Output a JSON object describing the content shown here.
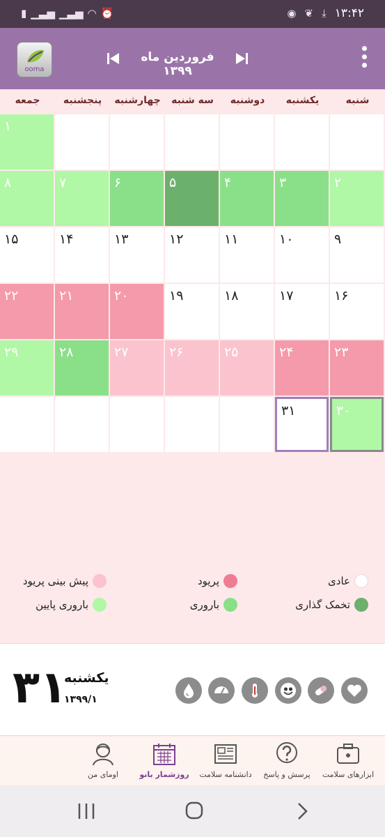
{
  "status_bar": {
    "time": "۱۳:۴۲",
    "left_icons": [
      "battery-saver-icon",
      "signal-icon",
      "signal-icon",
      "wifi-icon",
      "alarm-icon"
    ],
    "right_icons": [
      "trash-icon",
      "app-leaf-icon",
      "download-icon"
    ]
  },
  "header": {
    "logo_text": "ooma",
    "month_title": "فروردین ماه ۱۳۹۹",
    "prev_icon": "previous-month-icon",
    "next_icon": "next-month-icon",
    "menu_icon": "more-vert-icon"
  },
  "weekdays": [
    "شنبه",
    "یکشنبه",
    "دوشنبه",
    "سه شنبه",
    "چهارشنبه",
    "پنجشنبه",
    "جمعه"
  ],
  "calendar": {
    "rows": [
      [
        {
          "n": "",
          "t": "empty"
        },
        {
          "n": "",
          "t": "empty"
        },
        {
          "n": "",
          "t": "empty"
        },
        {
          "n": "",
          "t": "empty"
        },
        {
          "n": "",
          "t": "empty"
        },
        {
          "n": "",
          "t": "empty"
        },
        {
          "n": "۱",
          "t": "low"
        }
      ],
      [
        {
          "n": "۲",
          "t": "low"
        },
        {
          "n": "۳",
          "t": "fertile"
        },
        {
          "n": "۴",
          "t": "fertile"
        },
        {
          "n": "۵",
          "t": "ovul"
        },
        {
          "n": "۶",
          "t": "fertile"
        },
        {
          "n": "۷",
          "t": "low"
        },
        {
          "n": "۸",
          "t": "low"
        }
      ],
      [
        {
          "n": "۹",
          "t": "normal"
        },
        {
          "n": "۱۰",
          "t": "normal"
        },
        {
          "n": "۱۱",
          "t": "normal"
        },
        {
          "n": "۱۲",
          "t": "normal"
        },
        {
          "n": "۱۳",
          "t": "normal"
        },
        {
          "n": "۱۴",
          "t": "normal"
        },
        {
          "n": "۱۵",
          "t": "normal"
        }
      ],
      [
        {
          "n": "۱۶",
          "t": "normal"
        },
        {
          "n": "۱۷",
          "t": "normal"
        },
        {
          "n": "۱۸",
          "t": "normal"
        },
        {
          "n": "۱۹",
          "t": "normal"
        },
        {
          "n": "۲۰",
          "t": "period"
        },
        {
          "n": "۲۱",
          "t": "period"
        },
        {
          "n": "۲۲",
          "t": "period"
        }
      ],
      [
        {
          "n": "۲۳",
          "t": "period"
        },
        {
          "n": "۲۴",
          "t": "period"
        },
        {
          "n": "۲۵",
          "t": "predict"
        },
        {
          "n": "۲۶",
          "t": "predict"
        },
        {
          "n": "۲۷",
          "t": "predict"
        },
        {
          "n": "۲۸",
          "t": "fertile"
        },
        {
          "n": "۲۹",
          "t": "low"
        }
      ],
      [
        {
          "n": "۳۰",
          "t": "low",
          "sel": "green"
        },
        {
          "n": "۳۱",
          "t": "normal",
          "sel": "today"
        },
        {
          "n": "",
          "t": "empty"
        },
        {
          "n": "",
          "t": "empty"
        },
        {
          "n": "",
          "t": "empty"
        },
        {
          "n": "",
          "t": "empty"
        },
        {
          "n": "",
          "t": "empty"
        }
      ]
    ]
  },
  "legend": {
    "normal": {
      "label": "عادی",
      "color": "#ffffff"
    },
    "period": {
      "label": "پریود",
      "color": "#f07b93"
    },
    "predicted_period": {
      "label": "پیش بینی پریود",
      "color": "#fbc3cd"
    },
    "ovulation": {
      "label": "تخمک گذاری",
      "color": "#6bb06b"
    },
    "fertility": {
      "label": "باروری",
      "color": "#89e088"
    },
    "low_fertility": {
      "label": "باروری پایین",
      "color": "#b0f7a6"
    }
  },
  "selected_day": {
    "day_number": "۳۱",
    "weekday": "یکشنبه",
    "date": "۱۳۹۹/۱",
    "icons": [
      "drop-icon",
      "weight-scale-icon",
      "thermometer-icon",
      "smiley-icon",
      "pill-icon",
      "heart-icon"
    ]
  },
  "bottom_nav": [
    {
      "label": "ابزارهای سلامت",
      "icon": "first-aid-kit-icon"
    },
    {
      "label": "پرسش و پاسخ",
      "icon": "question-bubble-icon"
    },
    {
      "label": "دانشنامه سلامت",
      "icon": "newspaper-icon"
    },
    {
      "label": "روزشمار بانو",
      "icon": "calendar-icon",
      "active": true
    },
    {
      "label": "اومای من",
      "icon": "profile-icon"
    }
  ],
  "colors": {
    "status_bar": "#4a3a4c",
    "app_bar": "#9a74a9",
    "background": "#fde9ea",
    "accent": "#7b3f93"
  }
}
